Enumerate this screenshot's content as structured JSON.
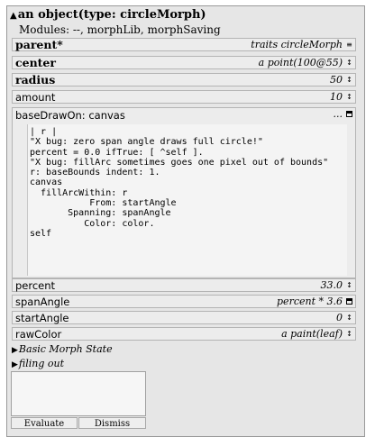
{
  "title": "an object(type: circleMorph)",
  "modules": "Modules: --, morphLib, morphSaving",
  "slots_top": [
    {
      "name": "parent*",
      "value": "traits circleMorph",
      "bold": true,
      "button": "≡"
    },
    {
      "name": "center",
      "value": "a point(100@55)",
      "bold": true,
      "button": "↕"
    },
    {
      "name": "radius",
      "value": "50",
      "bold": true,
      "button": "↕"
    },
    {
      "name": "amount",
      "value": "10",
      "bold": false,
      "button": "↕"
    }
  ],
  "method": {
    "name": "baseDrawOn: canvas",
    "value": "...",
    "code": "| r |\n\"X bug: zero span angle draws full circle!\"\npercent = 0.0 ifTrue: [ ^self ].\n\"X bug: fillArc sometimes goes one pixel out of bounds\"\nr: baseBounds indent: 1.\ncanvas\n  fillArcWithin: r\n           From: startAngle\n       Spanning: spanAngle\n          Color: color.\nself"
  },
  "slots_bottom": [
    {
      "name": "percent",
      "value": "33.0",
      "button": "↕"
    },
    {
      "name": "spanAngle",
      "value": "percent * 3.6",
      "button": "square"
    },
    {
      "name": "startAngle",
      "value": "0",
      "button": "↕"
    },
    {
      "name": "rawColor",
      "value": "a paint(leaf)",
      "button": "↕"
    }
  ],
  "categories": [
    "Basic Morph State",
    "filing out"
  ],
  "buttons": {
    "evaluate": "Evaluate",
    "dismiss": "Dismiss"
  }
}
